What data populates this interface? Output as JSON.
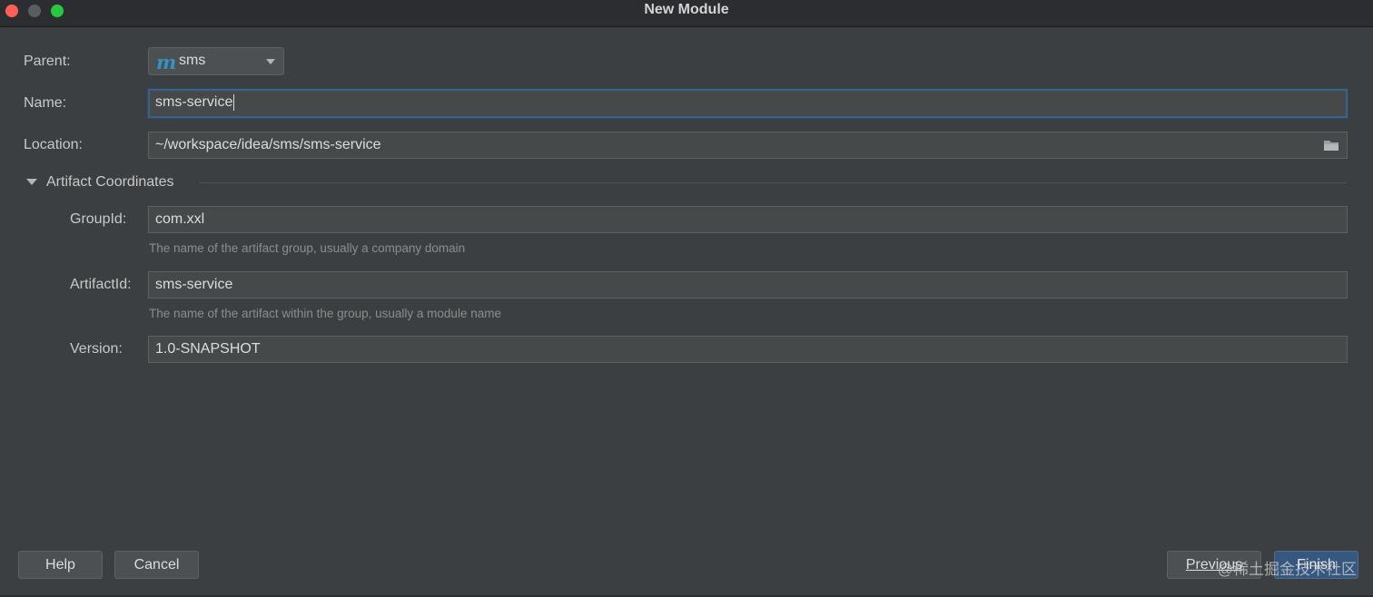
{
  "window": {
    "title": "New Module"
  },
  "form": {
    "parent_label": "Parent:",
    "parent_value": "sms",
    "parent_icon": "maven-module-icon",
    "name_label": "Name:",
    "name_value": "sms-service",
    "location_label": "Location:",
    "location_value": "~/workspace/idea/sms/sms-service"
  },
  "artifact": {
    "section_title": "Artifact Coordinates",
    "group_label": "GroupId:",
    "group_value": "com.xxl",
    "group_hint": "The name of the artifact group, usually a company domain",
    "artifact_label": "ArtifactId:",
    "artifact_value": "sms-service",
    "artifact_hint": "The name of the artifact within the group, usually a module name",
    "version_label": "Version:",
    "version_value": "1.0-SNAPSHOT"
  },
  "buttons": {
    "help": "Help",
    "cancel": "Cancel",
    "previous": "Previous",
    "finish": "Finish"
  },
  "watermark": "@稀土掘金技术社区",
  "colors": {
    "background": "#3c3f41",
    "field": "#45494a",
    "focus_border": "#3d6185",
    "default_button": "#365880",
    "maven_icon": "#3592c4"
  }
}
